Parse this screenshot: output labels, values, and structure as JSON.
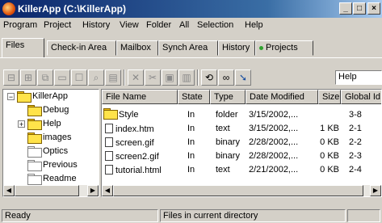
{
  "window": {
    "title": "KillerApp (C:\\KillerApp)",
    "buttons": [
      "minimize-icon",
      "maximize-icon",
      "close-icon"
    ]
  },
  "menu": [
    "Program",
    "Project",
    "History",
    "View",
    "Folder",
    "All",
    "Selection",
    "Help"
  ],
  "tabs": [
    "Files",
    "Check-in Area",
    "Mailbox",
    "Synch Area",
    "History",
    "Projects"
  ],
  "active_tab": "Files",
  "toolbar": {
    "icons": [
      "add-icon",
      "remove-icon",
      "copy-icon",
      "open-folder-icon",
      "properties-icon",
      "search-icon",
      "history-icon",
      "cut-icon",
      "cut2-icon",
      "paste-icon",
      "trash-icon",
      "refresh-icon",
      "glasses-icon",
      "help-arrow-icon"
    ],
    "help_value": "Help"
  },
  "tree": {
    "root": "KillerApp",
    "children": [
      "Debug",
      "Help",
      "images",
      "Optics",
      "Previous",
      "Readme"
    ]
  },
  "list": {
    "columns": [
      "File Name",
      "State",
      "Type",
      "Date Modified",
      "Size",
      "Global Id"
    ],
    "rows": [
      {
        "name": "Style",
        "state": "In",
        "type": "folder",
        "date": "3/15/2002,...",
        "size": "",
        "id": "3-8"
      },
      {
        "name": "index.htm",
        "state": "In",
        "type": "text",
        "date": "3/15/2002,...",
        "size": "1 KB",
        "id": "2-1"
      },
      {
        "name": "screen.gif",
        "state": "In",
        "type": "binary",
        "date": "2/28/2002,...",
        "size": "0 KB",
        "id": "2-2"
      },
      {
        "name": "screen2.gif",
        "state": "In",
        "type": "binary",
        "date": "2/28/2002,...",
        "size": "0 KB",
        "id": "2-3"
      },
      {
        "name": "tutorial.html",
        "state": "In",
        "type": "text",
        "date": "2/21/2002,...",
        "size": "0 KB",
        "id": "2-4"
      }
    ]
  },
  "status": {
    "left": "Ready",
    "center": "Files in current directory"
  }
}
